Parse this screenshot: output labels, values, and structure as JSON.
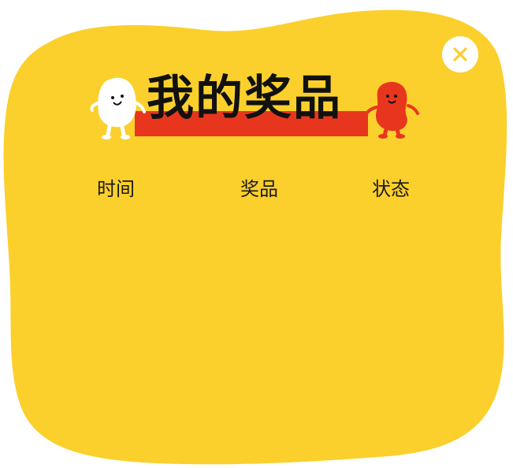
{
  "dialog": {
    "title": "我的奖品",
    "close_icon": "close-icon",
    "background_color": "#fbd02c",
    "accent_color": "#e8361e"
  },
  "table": {
    "columns": [
      "时间",
      "奖品",
      "状态"
    ],
    "rows": []
  },
  "mascots": {
    "left": "white-bean-mascot-icon",
    "right": "red-bean-mascot-icon"
  }
}
